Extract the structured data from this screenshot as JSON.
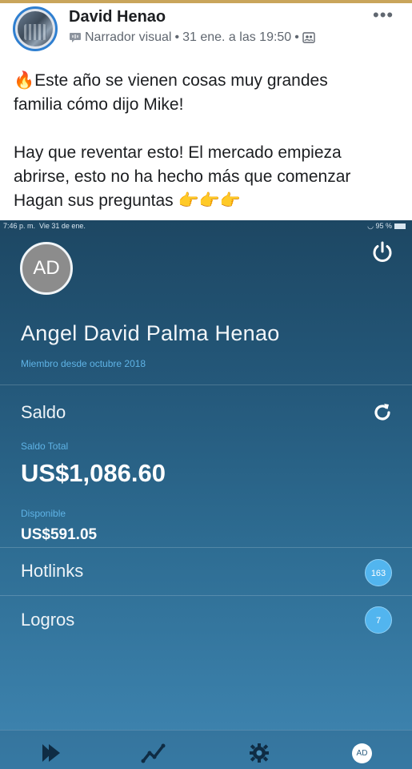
{
  "post": {
    "author": "David Henao",
    "meta_narrator": "Narrador visual",
    "meta_date": "31 ene. a las 19:50",
    "meta_sep": "•",
    "more": "•••",
    "line1": "Este año se vienen cosas muy grandes",
    "line2": "familia cómo dijo Mike!",
    "line3": "Hay que reventar esto! El mercado empieza",
    "line4": "abrirse, esto no ha hecho más que comenzar",
    "line5": "Hagan sus preguntas",
    "emoji_fire": "🔥",
    "emoji_point": "👉👉👉"
  },
  "app": {
    "status": {
      "time": "7:46 p. m.",
      "date": "Vie 31 de ene.",
      "battery": "95 %"
    },
    "avatar_initials": "AD",
    "name": "Angel David Palma Henao",
    "member_since": "Miembro desde octubre 2018",
    "saldo_label": "Saldo",
    "total_label": "Saldo Total",
    "total_value": "US$1,086.60",
    "available_label": "Disponible",
    "available_value": "US$591.05",
    "hotlinks_label": "Hotlinks",
    "hotlinks_count": "163",
    "logros_label": "Logros",
    "logros_count": "7",
    "tab_avatar": "AD"
  },
  "colors": {
    "accent": "#5fb3e6",
    "badge": "#52b5ef",
    "fb_border": "#2f7fd0"
  }
}
